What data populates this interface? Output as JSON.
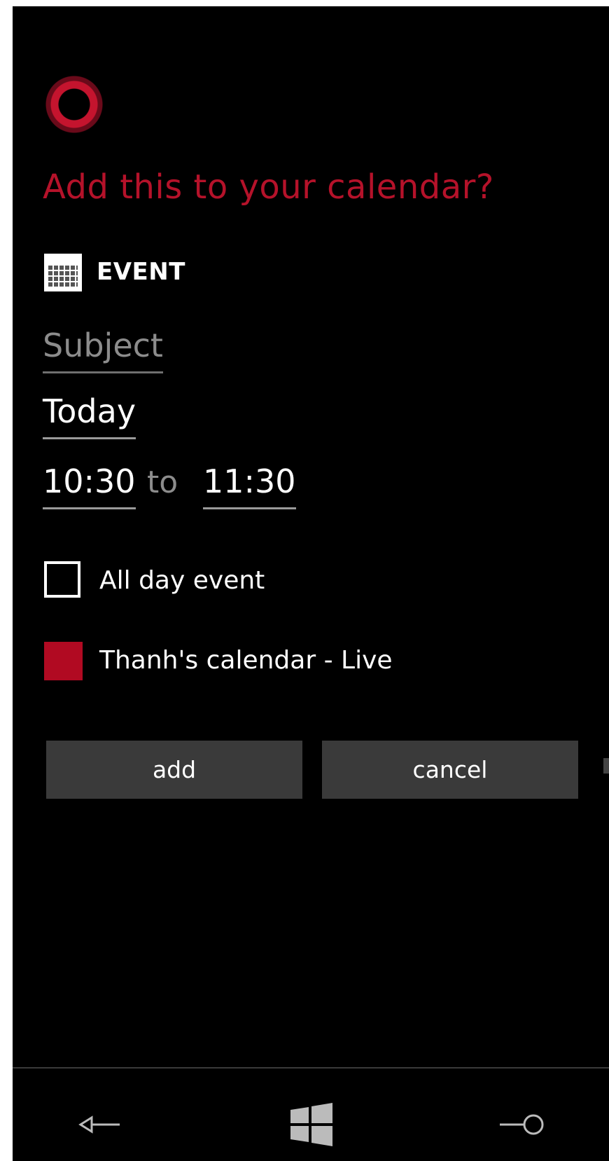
{
  "dialog": {
    "title": "Add this to your calendar?",
    "type_label": "EVENT"
  },
  "form": {
    "subject_placeholder": "Subject",
    "date_value": "Today",
    "start_time": "10:30",
    "to_word": "to",
    "end_time": "11:30",
    "all_day_label": "All day event",
    "all_day_checked": false,
    "calendar_label": "Thanh's calendar - Live",
    "calendar_color": "#b10a22"
  },
  "buttons": {
    "add_label": "add",
    "cancel_label": "cancel"
  },
  "navbar": {
    "back_icon": "back-arrow-icon",
    "start_icon": "windows-logo-icon",
    "search_icon": "search-icon"
  },
  "colors": {
    "accent": "#b5122a",
    "button_bg": "#3a3a3a"
  }
}
